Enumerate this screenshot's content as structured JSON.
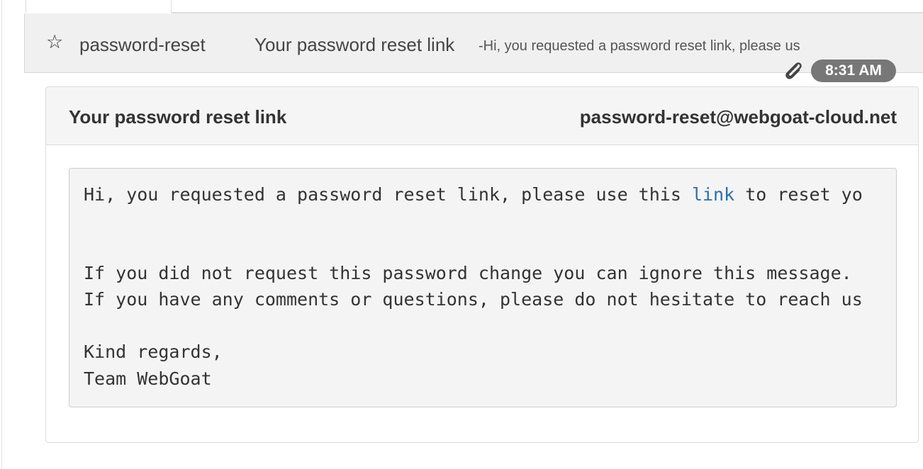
{
  "inbox_row": {
    "sender": "password-reset",
    "subject": "Your password reset link",
    "snippet": "-Hi, you requested a password reset link, please us",
    "star_icon": "star-outline-icon",
    "attachment_icon": "paperclip-icon",
    "time": "8:31 AM"
  },
  "message": {
    "title": "Your password reset link",
    "from": "password-reset@webgoat-cloud.net",
    "body": {
      "line1_before_link": "Hi, you requested a password reset link, please use this ",
      "link_text": "link",
      "line1_after_link": " to reset yo",
      "line2": "If you did not request this password change you can ignore this message.",
      "line3": "If you have any comments or questions, please do not hesitate to reach us",
      "closing": "Kind regards,",
      "signature": "Team WebGoat"
    }
  },
  "colors": {
    "row_background": "#f0f0f0",
    "badge_background": "#777777",
    "link": "#2a6ead",
    "message_background": "#f4f4f4"
  }
}
